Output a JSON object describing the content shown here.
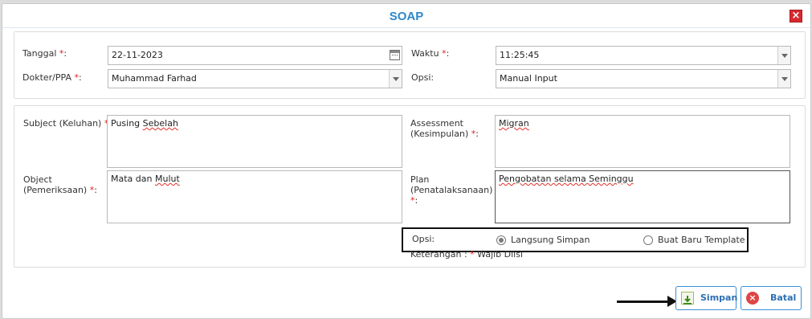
{
  "dialog": {
    "title": "SOAP",
    "close_icon": "close-icon"
  },
  "form": {
    "tanggal": {
      "label": "Tanggal ",
      "required": "*",
      "suffix": ":",
      "value": "22-11-2023",
      "icon": "calendar-icon"
    },
    "waktu": {
      "label": "Waktu ",
      "required": "*",
      "suffix": ":",
      "value": "11:25:45"
    },
    "dokter": {
      "label": "Dokter/PPA ",
      "required": "*",
      "suffix": ":",
      "value": "Muhammad Farhad"
    },
    "opsi_top": {
      "label": "Opsi:",
      "value": "Manual Input"
    }
  },
  "soap": {
    "subject": {
      "label": "Subject (Keluhan) ",
      "required": "*",
      "suffix": ":",
      "value_plain": "Pusing ",
      "value_flag": "Sebelah"
    },
    "assessment": {
      "label_line1": "Assessment",
      "label_line2": "(Kesimpulan) ",
      "required": "*",
      "suffix": ":",
      "value": "Migran"
    },
    "object": {
      "label_line1": "Object",
      "label_line2": "(Pemeriksaan) ",
      "required": "*",
      "suffix": ":",
      "value_plain": "Mata dan ",
      "value_flag": "Mulut"
    },
    "plan": {
      "label_line1": "Plan",
      "label_line2": "(Penatalaksanaan)",
      "required": "*",
      "suffix": ":",
      "value": "Pengobatan selama Seminggu"
    }
  },
  "opsi_save": {
    "label": "Opsi:",
    "option1": "Langsung Simpan",
    "option2": "Buat Baru Template",
    "selected": "Langsung Simpan"
  },
  "note": {
    "prefix": "Keterangan : ",
    "required": "*",
    "text": " Wajib Diisi"
  },
  "buttons": {
    "save": "Simpan",
    "cancel": "Batal"
  }
}
